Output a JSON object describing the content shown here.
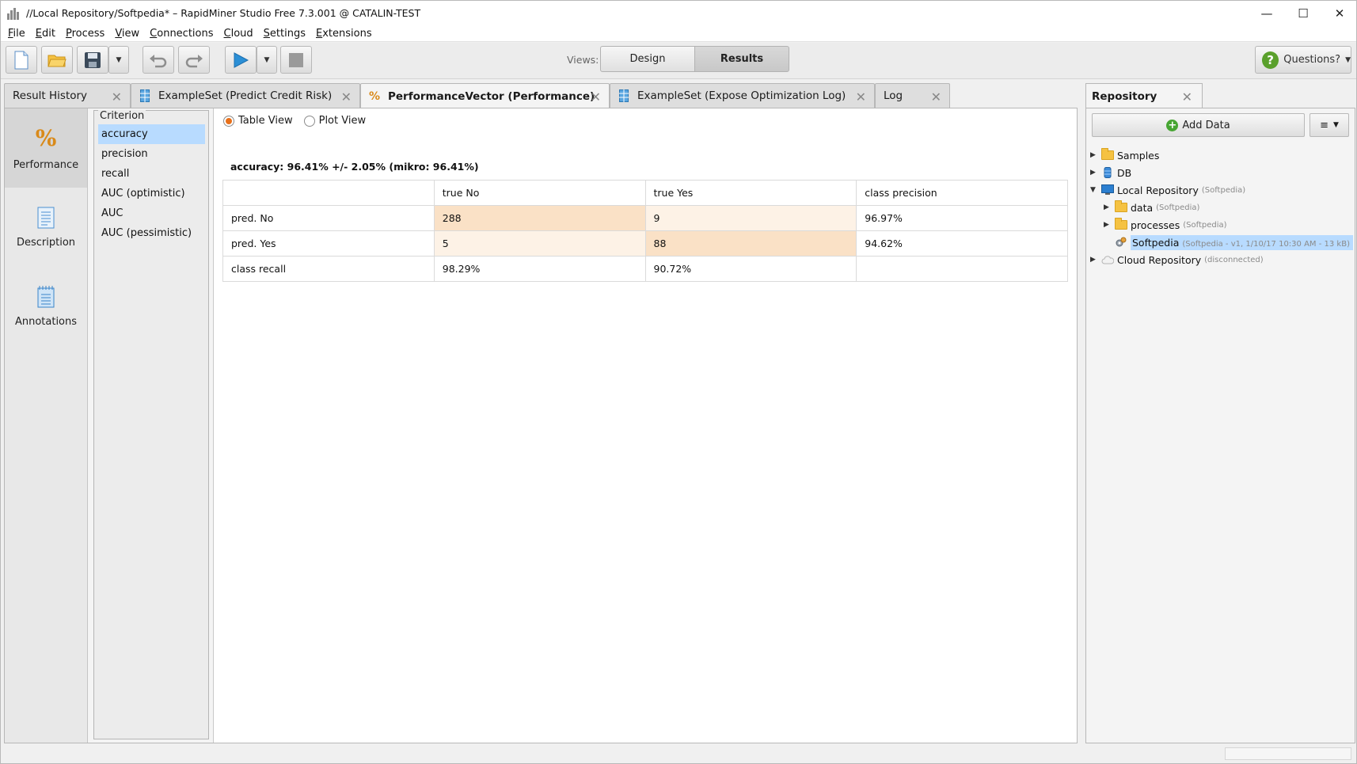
{
  "window": {
    "title": "//Local Repository/Softpedia* – RapidMiner Studio Free 7.3.001 @ CATALIN-TEST",
    "minimize": "—",
    "maximize": "☐",
    "close": "✕"
  },
  "menu": [
    "File",
    "Edit",
    "Process",
    "View",
    "Connections",
    "Cloud",
    "Settings",
    "Extensions"
  ],
  "toolbar": {
    "views_label": "Views:",
    "design_label": "Design",
    "results_label": "Results",
    "questions_label": "Questions?",
    "questions_icon": "?"
  },
  "tabs": [
    {
      "label": "Result History",
      "icon": "none",
      "active": false
    },
    {
      "label": "ExampleSet (Predict Credit Risk)",
      "icon": "table-icon",
      "active": false
    },
    {
      "label": "PerformanceVector (Performance)",
      "icon": "percent-icon",
      "active": true
    },
    {
      "label": "ExampleSet (Expose Optimization Log)",
      "icon": "table-icon",
      "active": false
    },
    {
      "label": "Log",
      "icon": "none",
      "active": false
    }
  ],
  "side_nav": [
    {
      "label": "Performance",
      "icon": "percent-icon",
      "active": true
    },
    {
      "label": "Description",
      "icon": "document-icon",
      "active": false
    },
    {
      "label": "Annotations",
      "icon": "notepad-icon",
      "active": false
    }
  ],
  "criterion": {
    "title": "Criterion",
    "items": [
      "accuracy",
      "precision",
      "recall",
      "AUC (optimistic)",
      "AUC",
      "AUC (pessimistic)"
    ],
    "selected": "accuracy"
  },
  "view_mode": {
    "table_label": "Table View",
    "plot_label": "Plot View",
    "selected": "Table View"
  },
  "performance": {
    "heading": "accuracy: 96.41% +/- 2.05% (mikro: 96.41%)",
    "columns": [
      "",
      "true No",
      "true Yes",
      "class precision"
    ],
    "rows": [
      [
        "pred. No",
        "288",
        "9",
        "96.97%"
      ],
      [
        "pred. Yes",
        "5",
        "88",
        "94.62%"
      ],
      [
        "class recall",
        "98.29%",
        "90.72%",
        ""
      ]
    ]
  },
  "repository": {
    "tab_label": "Repository",
    "add_data_label": "Add Data",
    "menu_icon": "≡",
    "tree": [
      {
        "label": "Samples",
        "note": "",
        "icon": "folder-icon",
        "level": 0,
        "expanded": false,
        "selected": false
      },
      {
        "label": "DB",
        "note": "",
        "icon": "database-icon",
        "level": 0,
        "expanded": false,
        "selected": false
      },
      {
        "label": "Local Repository",
        "note": "(Softpedia)",
        "icon": "monitor-icon",
        "level": 0,
        "expanded": true,
        "selected": false
      },
      {
        "label": "data",
        "note": "(Softpedia)",
        "icon": "folder-icon",
        "level": 1,
        "expanded": false,
        "selected": false
      },
      {
        "label": "processes",
        "note": "(Softpedia)",
        "icon": "folder-icon",
        "level": 1,
        "expanded": false,
        "selected": false
      },
      {
        "label": "Softpedia",
        "note": "(Softpedia - v1, 1/10/17 10:30 AM - 13 kB)",
        "icon": "gears-icon",
        "level": 1,
        "expanded": null,
        "selected": true
      },
      {
        "label": "Cloud Repository",
        "note": "(disconnected)",
        "icon": "cloud-icon",
        "level": 0,
        "expanded": false,
        "selected": false
      }
    ]
  },
  "colors": {
    "accent_orange": "#e8701a",
    "selection_blue": "#b8dbff",
    "diag_cell": "#fae1c6",
    "offdiag_cell": "#fdf2e6",
    "play_blue": "#2b8fd6"
  }
}
